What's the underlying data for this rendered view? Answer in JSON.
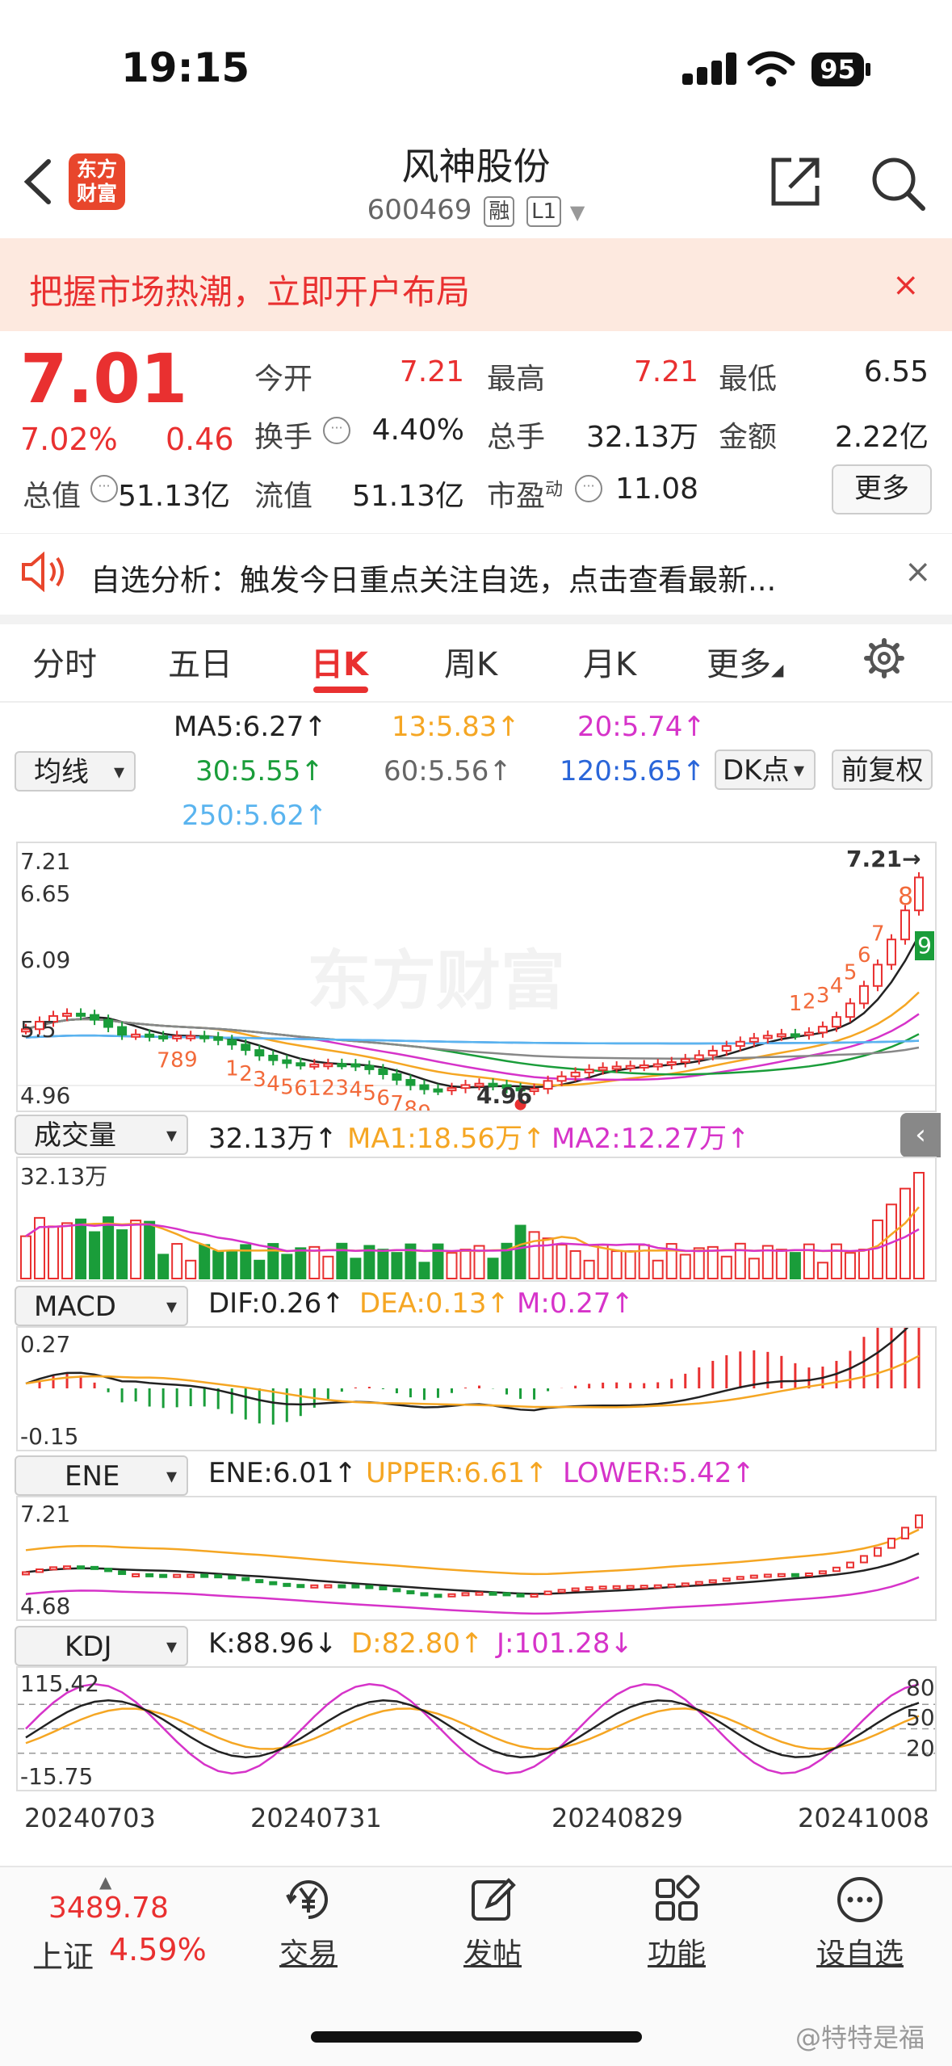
{
  "status": {
    "time": "19:15",
    "battery": "95"
  },
  "header": {
    "logo_line1": "东方",
    "logo_line2": "财富",
    "name": "风神股份",
    "code": "600469",
    "tag1": "融",
    "tag2": "L1"
  },
  "promo": {
    "text": "把握市场热潮，立即开户布局",
    "close": "×"
  },
  "quote": {
    "price": "7.01",
    "change_pct": "7.02%",
    "change": "0.46",
    "open_label": "今开",
    "open": "7.21",
    "high_label": "最高",
    "high": "7.21",
    "low_label": "最低",
    "low": "6.55",
    "turnover_label": "换手",
    "turnover": "4.40%",
    "volume_label": "总手",
    "volume": "32.13万",
    "amount_label": "金额",
    "amount": "2.22亿",
    "mktcap_label": "总值",
    "mktcap": "51.13亿",
    "float_label": "流值",
    "float": "51.13亿",
    "pe_label": "市盈",
    "pe_sup": "动",
    "pe": "11.08",
    "more": "更多"
  },
  "notice": {
    "text": "自选分析：触发今日重点关注自选，点击查看最新...",
    "close": "×"
  },
  "tabs": [
    "分时",
    "五日",
    "日K",
    "周K",
    "月K",
    "更多"
  ],
  "ma": {
    "selector": "均线",
    "ma5": "MA5:6.27↑",
    "ma13": "13:5.83↑",
    "ma20": "20:5.74↑",
    "ma30": "30:5.55↑",
    "ma60": "60:5.56↑",
    "ma120": "120:5.65↑",
    "ma250": "250:5.62↑",
    "dk": "DK点",
    "fq": "前复权"
  },
  "kline": {
    "y_labels": [
      "7.21",
      "6.65",
      "6.09",
      "5.5",
      "4.96"
    ],
    "max_label": "7.21→",
    "min_label": "4.96",
    "nine_top": "8",
    "nine_green": "9",
    "seq_labels": [
      "7",
      "8",
      "9",
      "1",
      "2",
      "3",
      "4",
      "5",
      "6",
      "1",
      "2",
      "3",
      "4",
      "5",
      "6",
      "7",
      "8",
      "9",
      "1",
      "2",
      "3",
      "4",
      "5",
      "6",
      "7"
    ],
    "watermark": "东方财富"
  },
  "volume": {
    "selector": "成交量",
    "val": "32.13万↑",
    "ma1": "MA1:18.56万↑",
    "ma2": "MA2:12.27万↑",
    "y_top": "32.13万"
  },
  "macd": {
    "selector": "MACD",
    "dif": "DIF:0.26↑",
    "dea": "DEA:0.13↑",
    "m": "M:0.27↑",
    "y_top": "0.27",
    "y_bot": "-0.15"
  },
  "ene": {
    "selector": "ENE",
    "ene": "ENE:6.01↑",
    "upper": "UPPER:6.61↑",
    "lower": "LOWER:5.42↑",
    "y_top": "7.21",
    "y_bot": "4.68"
  },
  "kdj": {
    "selector": "KDJ",
    "k": "K:88.96↓",
    "d": "D:82.80↑",
    "j": "J:101.28↓",
    "y_top": "115.42",
    "y_bot": "-15.75",
    "lv80": "80",
    "lv50": "50",
    "lv20": "20"
  },
  "dates": [
    "20240703",
    "20240731",
    "20240829",
    "20241008"
  ],
  "bottom": {
    "index_value": "3489.78",
    "index_name": "上证",
    "index_change": "4.59%",
    "trade": "交易",
    "post": "发帖",
    "func": "功能",
    "watch": "设自选"
  },
  "watermark": "@特特是福",
  "colors": {
    "red": "#e93030",
    "green": "#1a9d3a",
    "orange": "#f5a623",
    "magenta": "#d633c9",
    "blue": "#2a66d9"
  }
}
